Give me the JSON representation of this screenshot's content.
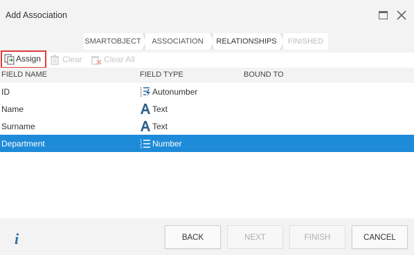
{
  "window": {
    "title": "Add Association"
  },
  "wizard": {
    "steps": [
      {
        "label": "SMARTOBJECT",
        "state": "done"
      },
      {
        "label": "ASSOCIATION",
        "state": "done"
      },
      {
        "label": "RELATIONSHIPS",
        "state": "current"
      },
      {
        "label": "FINISHED",
        "state": "pending"
      }
    ]
  },
  "toolbar": {
    "assign_label": "Assign",
    "clear_label": "Clear",
    "clear_all_label": "Clear All"
  },
  "grid": {
    "headers": [
      "FIELD NAME",
      "FIELD TYPE",
      "BOUND TO"
    ],
    "rows": [
      {
        "name": "ID",
        "type": "Autonumber",
        "type_icon": "autonumber-icon",
        "bound": ""
      },
      {
        "name": "Name",
        "type": "Text",
        "type_icon": "text-type-icon",
        "bound": ""
      },
      {
        "name": "Surname",
        "type": "Text",
        "type_icon": "text-type-icon",
        "bound": ""
      },
      {
        "name": "Department",
        "type": "Number",
        "type_icon": "number-icon",
        "bound": "",
        "selected": true
      }
    ]
  },
  "footer": {
    "info_icon": "info-icon",
    "back_label": "BACK",
    "next_label": "NEXT",
    "finish_label": "FINISH",
    "cancel_label": "CANCEL"
  },
  "colors": {
    "selection": "#1e8bd8",
    "highlight_border": "#e03a3a",
    "icon_blue": "#2b6ea3"
  }
}
